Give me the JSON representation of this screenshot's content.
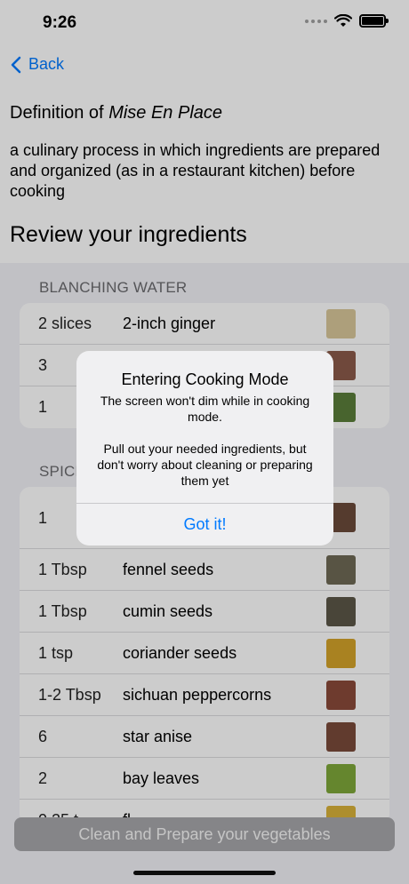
{
  "status_bar": {
    "time": "9:26"
  },
  "nav": {
    "back_label": "Back"
  },
  "definition": {
    "title_prefix": "Definition of",
    "title_term": "Mise En Place",
    "text": "a culinary process in which ingredients are prepared and organized (as in a restaurant kitchen) before cooking"
  },
  "review_title": "Review your ingredients",
  "sections": [
    {
      "header": "BLANCHING WATER",
      "rows": [
        {
          "qty": "2 slices",
          "name": "2-inch ginger",
          "thumb_color": "#d9c79a"
        },
        {
          "qty": "3",
          "name": "",
          "thumb_color": "#8b5a4a"
        },
        {
          "qty": "1",
          "name": "",
          "thumb_color": "#5a7d3a"
        }
      ]
    },
    {
      "header": "SPICES",
      "rows": [
        {
          "qty": "1",
          "name": "",
          "thumb_color": "#6b4a3a"
        },
        {
          "qty": "1 Tbsp",
          "name": "fennel seeds",
          "thumb_color": "#6e6a55"
        },
        {
          "qty": "1 Tbsp",
          "name": "cumin seeds",
          "thumb_color": "#5c5748"
        },
        {
          "qty": "1 tsp",
          "name": "coriander seeds",
          "thumb_color": "#d4a32a"
        },
        {
          "qty": "1-2 Tbsp",
          "name": "sichuan peppercorns",
          "thumb_color": "#8a4a3a"
        },
        {
          "qty": "6",
          "name": "star anise",
          "thumb_color": "#7a4a3a"
        },
        {
          "qty": "2",
          "name": "bay leaves",
          "thumb_color": "#7fa83a"
        },
        {
          "qty": "0.25 t",
          "name": "fl",
          "thumb_color": "#d9b23a"
        }
      ]
    }
  ],
  "bottom_button": {
    "label": "Clean and Prepare your vegetables"
  },
  "alert": {
    "title": "Entering Cooking Mode",
    "message": "The screen won't dim while in cooking mode.\n\nPull out your needed ingredients, but don't worry about cleaning or preparing them yet",
    "button": "Got it!"
  },
  "colors": {
    "accent": "#007aff",
    "overlay": "rgba(0,0,0,0.2)"
  }
}
